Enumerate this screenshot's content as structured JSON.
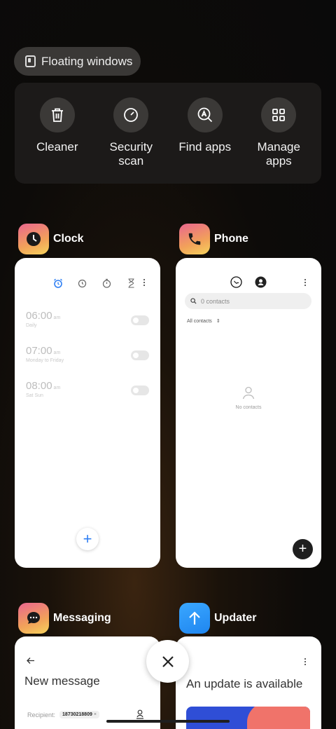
{
  "floating_windows": {
    "label": "Floating windows"
  },
  "quick_actions": [
    {
      "label": "Cleaner",
      "icon": "trash-icon"
    },
    {
      "label": "Security scan",
      "icon": "security-scan-icon"
    },
    {
      "label": "Find apps",
      "icon": "find-apps-icon"
    },
    {
      "label": "Manage apps",
      "icon": "grid-icon"
    }
  ],
  "recent_apps": {
    "clock": {
      "name": "Clock",
      "alarms": [
        {
          "time": "06:00",
          "ampm": "am",
          "repeat": "Daily",
          "enabled": false
        },
        {
          "time": "07:00",
          "ampm": "am",
          "repeat": "Monday to Friday",
          "enabled": false
        },
        {
          "time": "08:00",
          "ampm": "am",
          "repeat": "Sat Sun",
          "enabled": false
        }
      ],
      "add_symbol": "+"
    },
    "phone": {
      "name": "Phone",
      "search_placeholder": "0 contacts",
      "filter_label": "All contacts",
      "empty_text": "No contacts",
      "add_symbol": "+"
    },
    "messaging": {
      "name": "Messaging",
      "title": "New message",
      "recipient_label": "Recipient:",
      "recipient_chip": "18730218809",
      "chip_close": "×"
    },
    "updater": {
      "name": "Updater",
      "title": "An update is available"
    }
  },
  "close_all": {
    "symbol": "✕"
  }
}
